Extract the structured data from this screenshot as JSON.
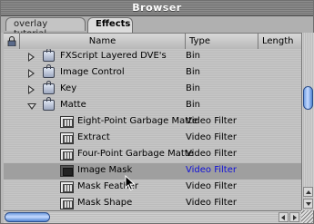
{
  "window": {
    "title": "Browser"
  },
  "tabs": [
    {
      "label": "overlay tutorial",
      "active": false
    },
    {
      "label": "Effects",
      "active": true
    }
  ],
  "columns": {
    "name": "Name",
    "type": "Type",
    "length": "Length"
  },
  "rows": [
    {
      "name": "FXScript Layered DVE's",
      "type": "Bin",
      "kind": "bin",
      "expanded": false
    },
    {
      "name": "Image Control",
      "type": "Bin",
      "kind": "bin",
      "expanded": false
    },
    {
      "name": "Key",
      "type": "Bin",
      "kind": "bin",
      "expanded": false
    },
    {
      "name": "Matte",
      "type": "Bin",
      "kind": "bin",
      "expanded": true
    },
    {
      "name": "Eight-Point Garbage Matte",
      "type": "Video Filter",
      "kind": "filter"
    },
    {
      "name": "Extract",
      "type": "Video Filter",
      "kind": "filter"
    },
    {
      "name": "Four-Point Garbage Matte",
      "type": "Video Filter",
      "kind": "filter"
    },
    {
      "name": "Image Mask",
      "type": "Video Filter",
      "kind": "filter",
      "selected": true
    },
    {
      "name": "Mask Feather",
      "type": "Video Filter",
      "kind": "filter"
    },
    {
      "name": "Mask Shape",
      "type": "Video Filter",
      "kind": "filter"
    }
  ],
  "colors": {
    "selected_type_text": "#1010d8",
    "scroll_thumb": "#6f9de0"
  }
}
